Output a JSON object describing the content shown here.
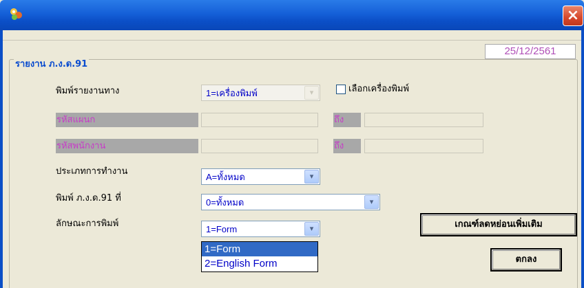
{
  "window": {
    "date": "25/12/2561",
    "close_icon": "close-icon"
  },
  "group": {
    "title": "รายงาน ภ.ง.ด.91"
  },
  "form": {
    "print_via_label": "พิมพ์รายงานทาง",
    "print_via_value": "1=เครื่องพิมพ์",
    "select_printer_label": "เลือกเครื่องพิมพ์",
    "select_printer_checked": false,
    "dept_code_label": "รหัสแผนก",
    "dept_code_to_label": "ถึง",
    "emp_code_label": "รหัสพนักงาน",
    "emp_code_to_label": "ถึง",
    "work_type_label": "ประเภทการทำงาน",
    "work_type_value": "A=ทั้งหมด",
    "print_pnd_label": "พิมพ์ ภ.ง.ด.91 ที่",
    "print_pnd_value": "0=ทั้งหมด",
    "print_style_label": "ลักษณะการพิมพ์",
    "print_style_value": "1=Form",
    "print_style_options": [
      "1=Form",
      "2=English Form"
    ],
    "print_style_selected_index": 0
  },
  "buttons": {
    "extra_deduction": "เกณฑ์ลดหย่อนเพิ่มเติม",
    "ok": "ตกลง"
  }
}
